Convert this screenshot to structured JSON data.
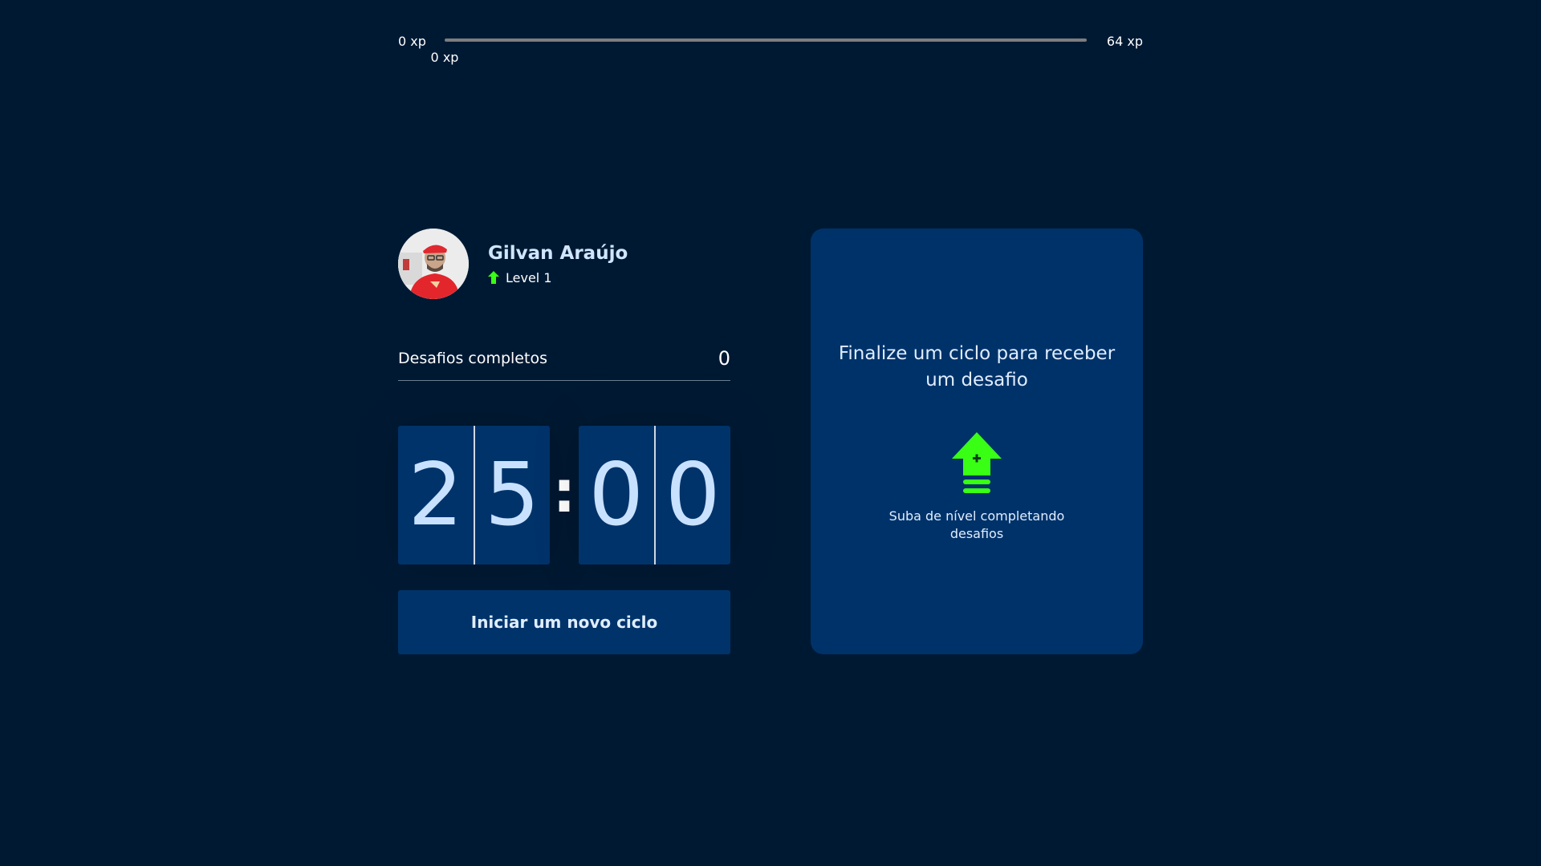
{
  "xp": {
    "min_label": "0 xp",
    "max_label": "64 xp",
    "current_label": "0 xp",
    "current_fraction": 0.0
  },
  "profile": {
    "name": "Gilvan Araújo",
    "level_label": "Level 1",
    "avatar_icon": "user-avatar-photo",
    "level_icon": "level-up-arrow-icon"
  },
  "challenges": {
    "completed_label": "Desafios completos",
    "completed_value": "0"
  },
  "countdown": {
    "minute_left": "2",
    "minute_right": "5",
    "separator": ":",
    "second_left": "0",
    "second_right": "0"
  },
  "start_button": {
    "label": "Iniciar um novo ciclo"
  },
  "challenge_box": {
    "title": "Finalize um ciclo para receber um desafio",
    "hint": "Suba de nível completando desafios",
    "icon": "level-up-icon"
  },
  "colors": {
    "background": "#001933",
    "card": "#00326a",
    "accent_green": "#39ff14",
    "text_light": "#cfe6ff"
  }
}
